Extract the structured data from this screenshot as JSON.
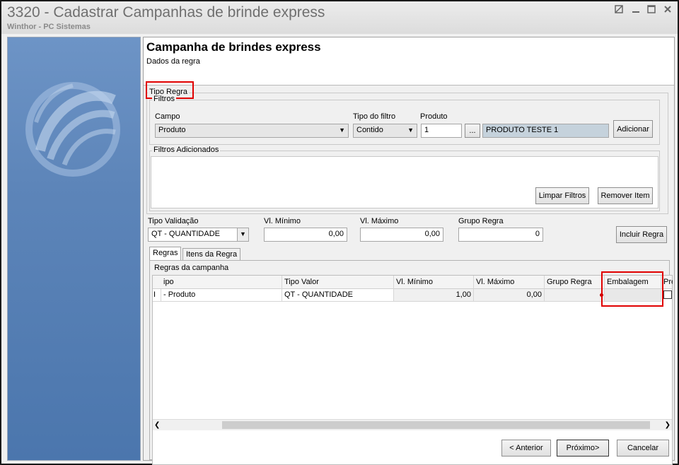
{
  "window": {
    "title": "3320 - Cadastrar Campanhas de brinde express",
    "subtitle": "Winthor - PC Sistemas"
  },
  "header": {
    "title": "Campanha de brindes express",
    "subtitle": "Dados da regra"
  },
  "tipo_regra": {
    "legend": "Tipo Regra",
    "filtros": {
      "legend": "Filtros",
      "campo_label": "Campo",
      "campo_value": "Produto",
      "tipo_filtro_label": "Tipo do filtro",
      "tipo_filtro_value": "Contido",
      "produto_label": "Produto",
      "produto_code": "1",
      "produto_browse": "...",
      "produto_desc": "PRODUTO TESTE 1",
      "adicionar_button": "Adicionar"
    },
    "filtros_adicionados": {
      "legend": "Filtros Adicionados",
      "limpar_button": "Limpar Filtros",
      "remover_button": "Remover Item"
    }
  },
  "validacao": {
    "tipo_label": "Tipo Validação",
    "tipo_value": "QT - QUANTIDADE",
    "vl_minimo_label": "Vl. Mínimo",
    "vl_minimo_value": "0,00",
    "vl_maximo_label": "Vl. Máximo",
    "vl_maximo_value": "0,00",
    "grupo_label": "Grupo Regra",
    "grupo_value": "0",
    "incluir_button": "Incluir Regra"
  },
  "tabs": [
    {
      "label": "Regras"
    },
    {
      "label": "Itens da Regra"
    }
  ],
  "regras": {
    "legend": "Regras da campanha",
    "columns": [
      "ipo",
      "Tipo Valor",
      "Vl. Mínimo",
      "Vl. Máximo",
      "Grupo Regra",
      "Embalagem",
      "Pre"
    ],
    "rows": [
      {
        "indicator": "I",
        "tipo": "- Produto",
        "tipo_valor": "QT - QUANTIDADE",
        "vl_minimo": "1,00",
        "vl_maximo": "0,00",
        "grupo": "",
        "embalagem": ""
      }
    ]
  },
  "footer": {
    "anterior_button": "< Anterior",
    "proximo_button": "Próximo>",
    "cancelar_button": "Cancelar"
  },
  "colors": {
    "highlight": "#e00000",
    "sidebar": "#5d85b9",
    "product_field": "#c5d2dc"
  }
}
